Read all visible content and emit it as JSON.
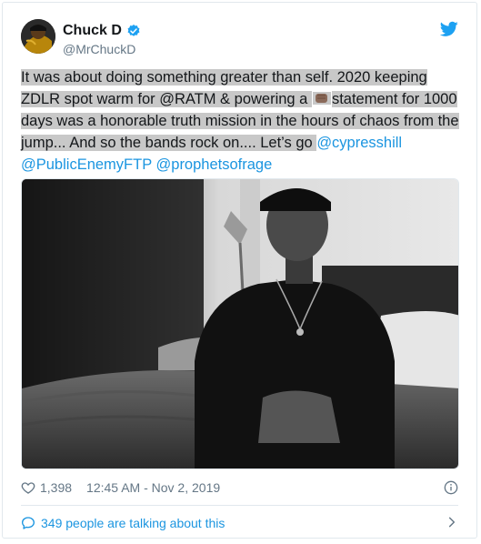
{
  "colors": {
    "link": "#1b95e0",
    "text": "#14171a",
    "muted": "#657786",
    "verified": "#1da1f2",
    "highlight": "#c8c8c8"
  },
  "author": {
    "display_name": "Chuck D",
    "handle": "@MrChuckD"
  },
  "icons": {
    "verified": "verified-badge-icon",
    "brand": "twitter-bird-icon",
    "like": "heart-icon",
    "info": "info-icon",
    "reply": "speech-bubble-icon",
    "more": "chevron-right-icon",
    "emoji": "raised-fist-emoji"
  },
  "tweet": {
    "text_1": "It was about doing something greater than self. 2020 keeping ZDLR spot warm for @RATM & powering a ",
    "text_2": "statement for 1000 days was a honorable truth mission in the hours of chaos from the jump... And so the bands rock on.... Let’s go ",
    "mention_1": "@cypresshill",
    "mention_2": "@PublicEnemyFTP",
    "mention_3": "@prophetsofrage"
  },
  "meta": {
    "likes": "1,398",
    "timestamp": "12:45 AM - Nov 2, 2019"
  },
  "footer": {
    "talking": "349 people are talking about this"
  }
}
